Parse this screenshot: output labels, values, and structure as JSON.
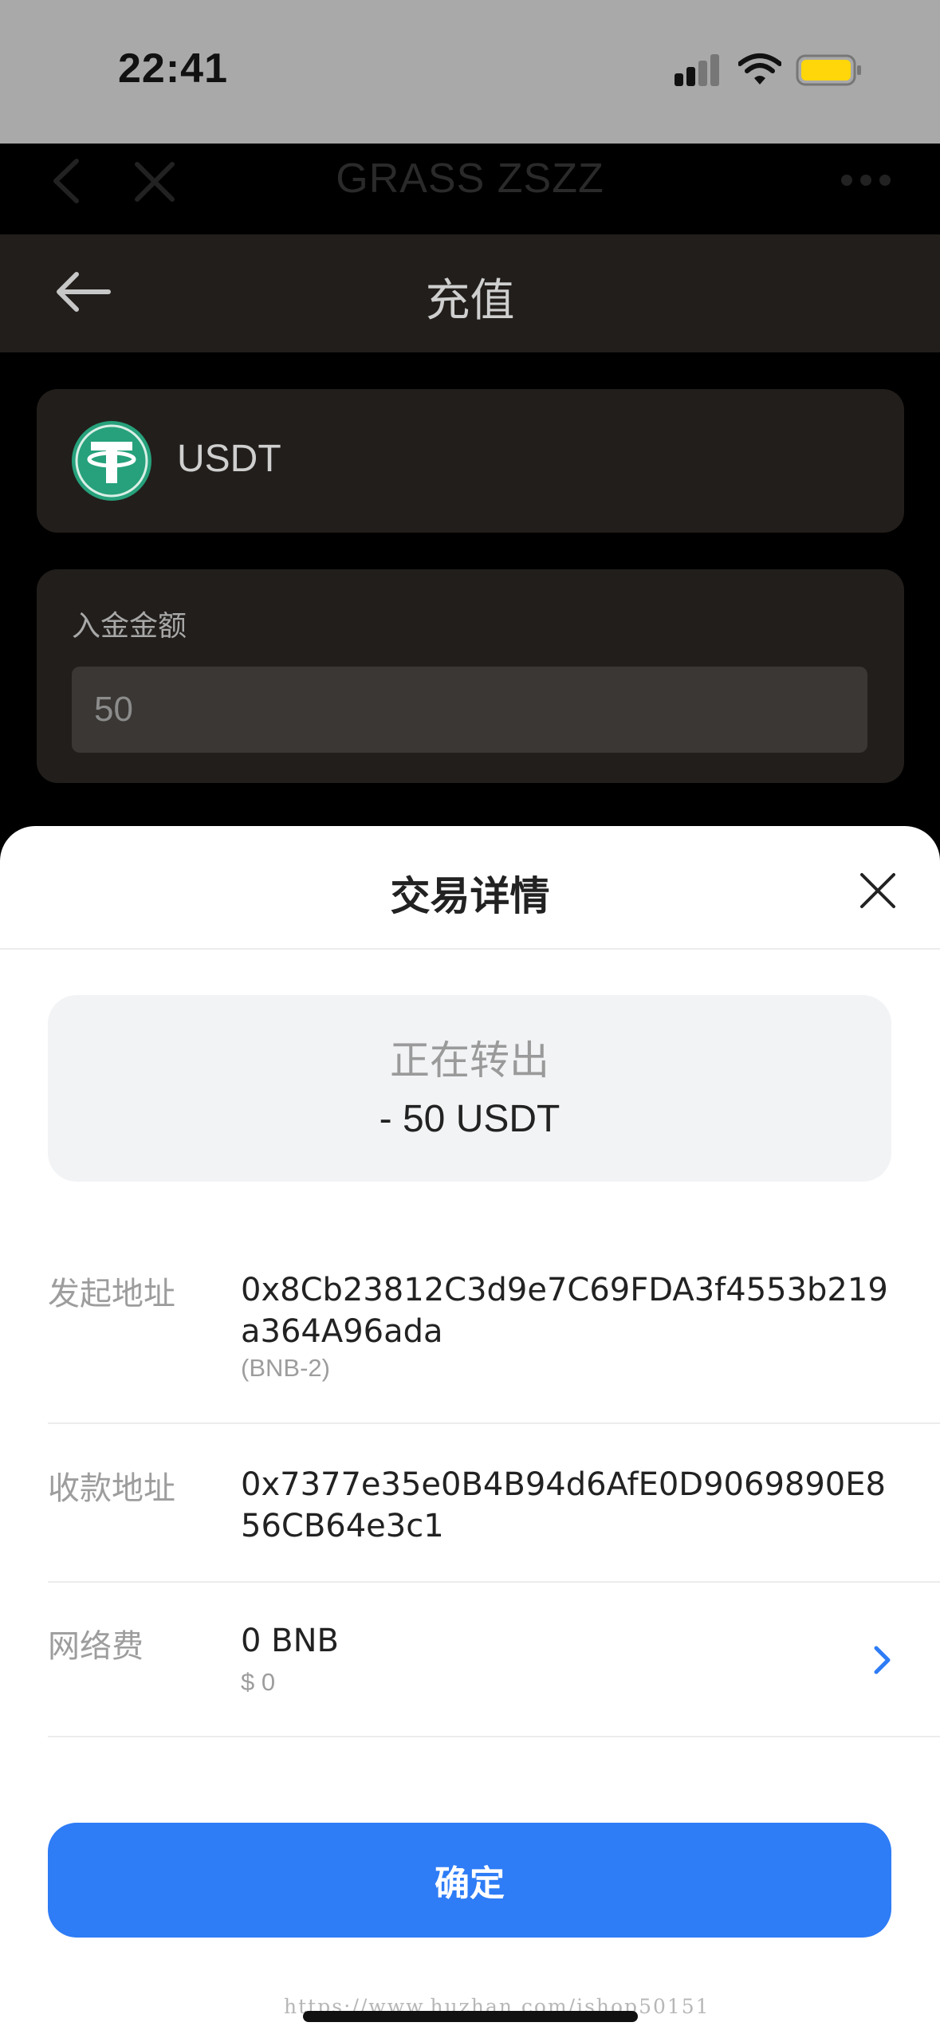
{
  "status_bar": {
    "time": "22:41"
  },
  "browser_nav": {
    "title": "GRASS ZSZZ"
  },
  "app": {
    "title": "充值",
    "coin": {
      "name": "USDT"
    },
    "amount": {
      "label": "入金金额",
      "value": "50"
    }
  },
  "sheet": {
    "title": "交易详情",
    "summary": {
      "status": "正在转出",
      "amount": "- 50 USDT"
    },
    "rows": [
      {
        "label": "发起地址",
        "value": "0x8Cb23812C3d9e7C69FDA3f4553b219a364A96ada",
        "sub": "(BNB-2)"
      },
      {
        "label": "收款地址",
        "value": "0x7377e35e0B4B94d6AfE0D9069890E856CB64e3c1"
      },
      {
        "label": "网络费",
        "value": "0 BNB",
        "sub": "$ 0"
      }
    ],
    "confirm_label": "确定"
  },
  "watermark": "https://www.huzhan.com/ishop50151",
  "colors": {
    "accent": "#2e7cf6",
    "usdt_green": "#26a17b",
    "battery": "#ffd60a"
  },
  "icons": [
    "back-chevron-icon",
    "close-icon",
    "more-icon",
    "arrow-left-icon",
    "usdt-logo-icon",
    "chevron-right-icon",
    "signal-icon",
    "wifi-icon",
    "battery-icon"
  ]
}
